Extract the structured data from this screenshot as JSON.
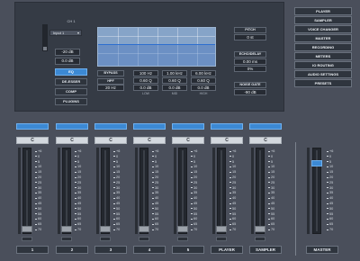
{
  "channel": {
    "title": "CH 1",
    "input": "Input 1",
    "gain": "-20 dB",
    "level": "0.0 dB",
    "processors": [
      {
        "label": "EQ",
        "active": true
      },
      {
        "label": "DE-ESSER",
        "active": false
      },
      {
        "label": "COMP",
        "active": false
      },
      {
        "label": "PLUGINS",
        "active": false
      }
    ]
  },
  "eq": {
    "bypass_label": "BYPASS",
    "hpf_label": "HPF",
    "hpf_value": "20 Hz",
    "bands": [
      {
        "name": "LOW",
        "freq": "100 Hz",
        "q": "0.60 Q",
        "gain": "0.0 dB"
      },
      {
        "name": "MID",
        "freq": "1.00 kHz",
        "q": "0.60 Q",
        "gain": "0.0 dB"
      },
      {
        "name": "HIGH",
        "freq": "6.00 kHz",
        "q": "0.60 Q",
        "gain": "0.0 dB"
      }
    ]
  },
  "effects": {
    "pitch": {
      "title": "PITCH",
      "value": "0 st"
    },
    "echo": {
      "title": "ECHO/DELAY",
      "time": "0.00 ms",
      "mix": "0%"
    },
    "gate": {
      "title": "NOISE GATE",
      "value": "-90 dB"
    }
  },
  "menu": [
    "PLAYER",
    "SAMPLER",
    "VOICE CHANGER",
    "MASTER",
    "RECORDING",
    "METERS",
    "IO ROUTING",
    "AUDIO SETTINGS",
    "PRESETS"
  ],
  "scale_labels": [
    "+6",
    "0",
    "5",
    "10",
    "15",
    "20",
    "25",
    "30",
    "35",
    "40",
    "45",
    "50",
    "55",
    "60",
    "65",
    "70"
  ],
  "mixer": {
    "channels": [
      {
        "name": "1",
        "pan": "C"
      },
      {
        "name": "2",
        "pan": "C"
      },
      {
        "name": "3",
        "pan": "C"
      },
      {
        "name": "4",
        "pan": "C"
      },
      {
        "name": "5",
        "pan": "C"
      },
      {
        "name": "PLAYER",
        "pan": "C"
      },
      {
        "name": "SAMPLER",
        "pan": "C"
      }
    ],
    "master": {
      "name": "MASTER"
    }
  },
  "colors": {
    "accent": "#3c89d4",
    "panel": "#353b45",
    "background": "#4a4f5b"
  }
}
